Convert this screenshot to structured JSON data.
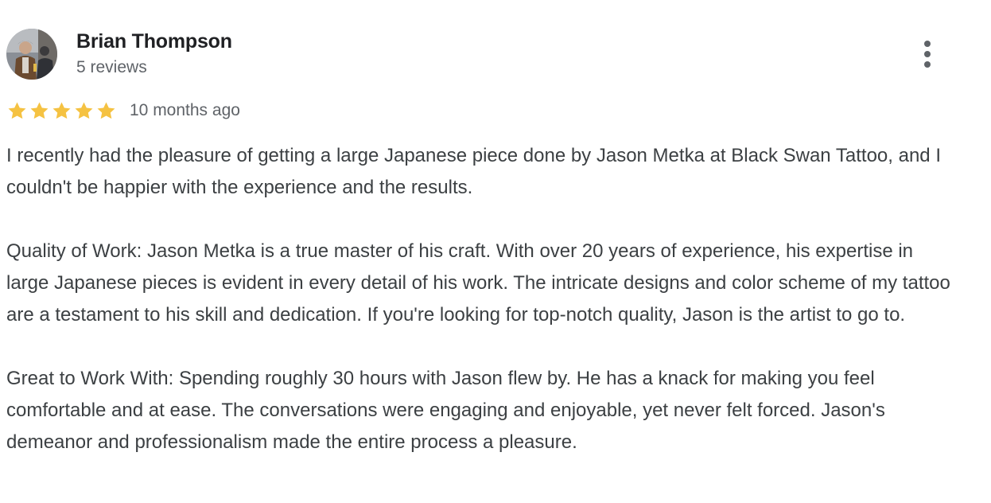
{
  "reviewer": {
    "name": "Brian Thompson",
    "meta": "5 reviews",
    "avatar_icon": "profile-photo"
  },
  "actions": {
    "more_icon": "more-vert-icon"
  },
  "rating": {
    "stars": 5,
    "max_stars": 5,
    "star_color": "#f5c242",
    "date": "10 months ago"
  },
  "review": {
    "paragraphs": [
      "I recently had the pleasure of getting a large Japanese piece done by Jason Metka at Black Swan Tattoo, and I couldn't be happier with the experience and the results.",
      "Quality of Work: Jason Metka is a true master of his craft. With over 20 years of experience, his expertise in large Japanese pieces is evident in every detail of his work. The intricate designs and color scheme of my tattoo are a testament to his skill and dedication. If you're looking for top-notch quality, Jason is the artist to go to.",
      "Great to Work With: Spending roughly 30 hours with Jason flew by. He has a knack for making you feel comfortable and at ease. The conversations were engaging and enjoyable, yet never felt forced. Jason's demeanor and professionalism made the entire process a pleasure."
    ]
  }
}
